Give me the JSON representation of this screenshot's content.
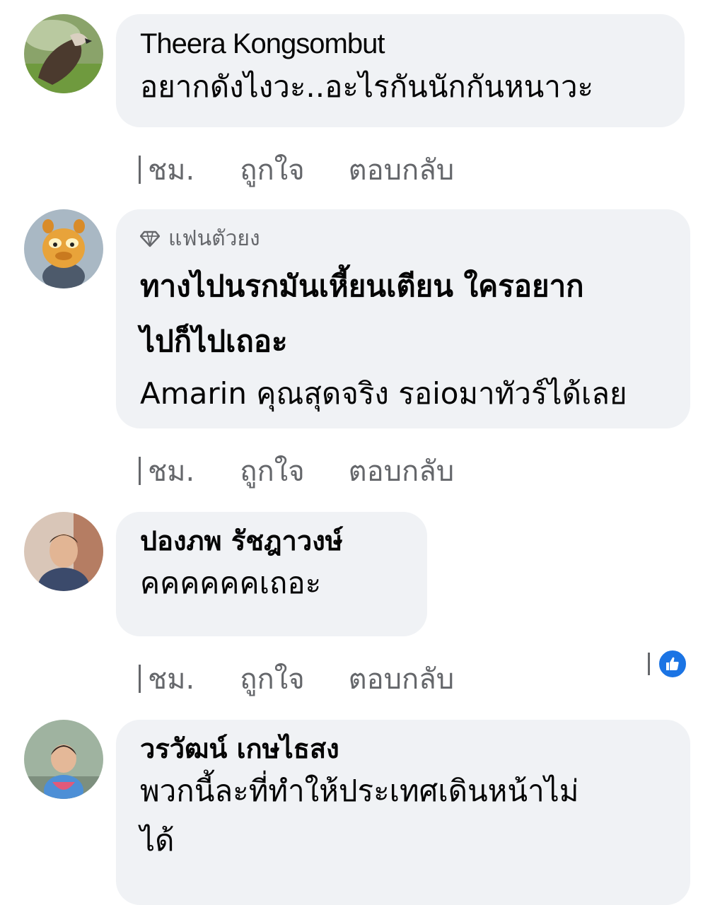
{
  "comments": [
    {
      "author": "Theera Kongsombut",
      "badge": "",
      "text_lines": [
        "อยากดังไงวะ..อะไรกันนักกันหนาวะ"
      ],
      "time": "ชม.",
      "like_label": "ถูกใจ",
      "reply_label": "ตอบกลับ"
    },
    {
      "author": "",
      "badge": "แฟนตัวยง",
      "text_lines": [
        "ทางไปนรกมันเหี้ยนเตียน ใครอยาก",
        "ไปก็ไปเถอะ"
      ],
      "text_lines_2": [
        "Amarin คุณสุดจริง รอioมาทัวร์ได้เลย"
      ],
      "time": "ชม.",
      "like_label": "ถูกใจ",
      "reply_label": "ตอบกลับ"
    },
    {
      "author": "ปองภพ รัชฎาวงษ์",
      "badge": "",
      "text_lines": [
        "คคคคคคเถอะ"
      ],
      "time": "ชม.",
      "like_label": "ถูกใจ",
      "reply_label": "ตอบกลับ",
      "reaction": "like-icon"
    },
    {
      "author": "วรวัฒน์ เกษไธสง",
      "badge": "",
      "text_lines": [
        "พวกนี้ละที่ทำให้ประเทศเดินหน้าไม่",
        "ได้"
      ]
    }
  ],
  "colors": {
    "bubble": "#f0f2f5",
    "meta_text": "#65676b",
    "like_blue": "#1b74e4"
  },
  "icons": {
    "badge": "diamond-icon",
    "reaction": "thumbs-up-icon"
  }
}
